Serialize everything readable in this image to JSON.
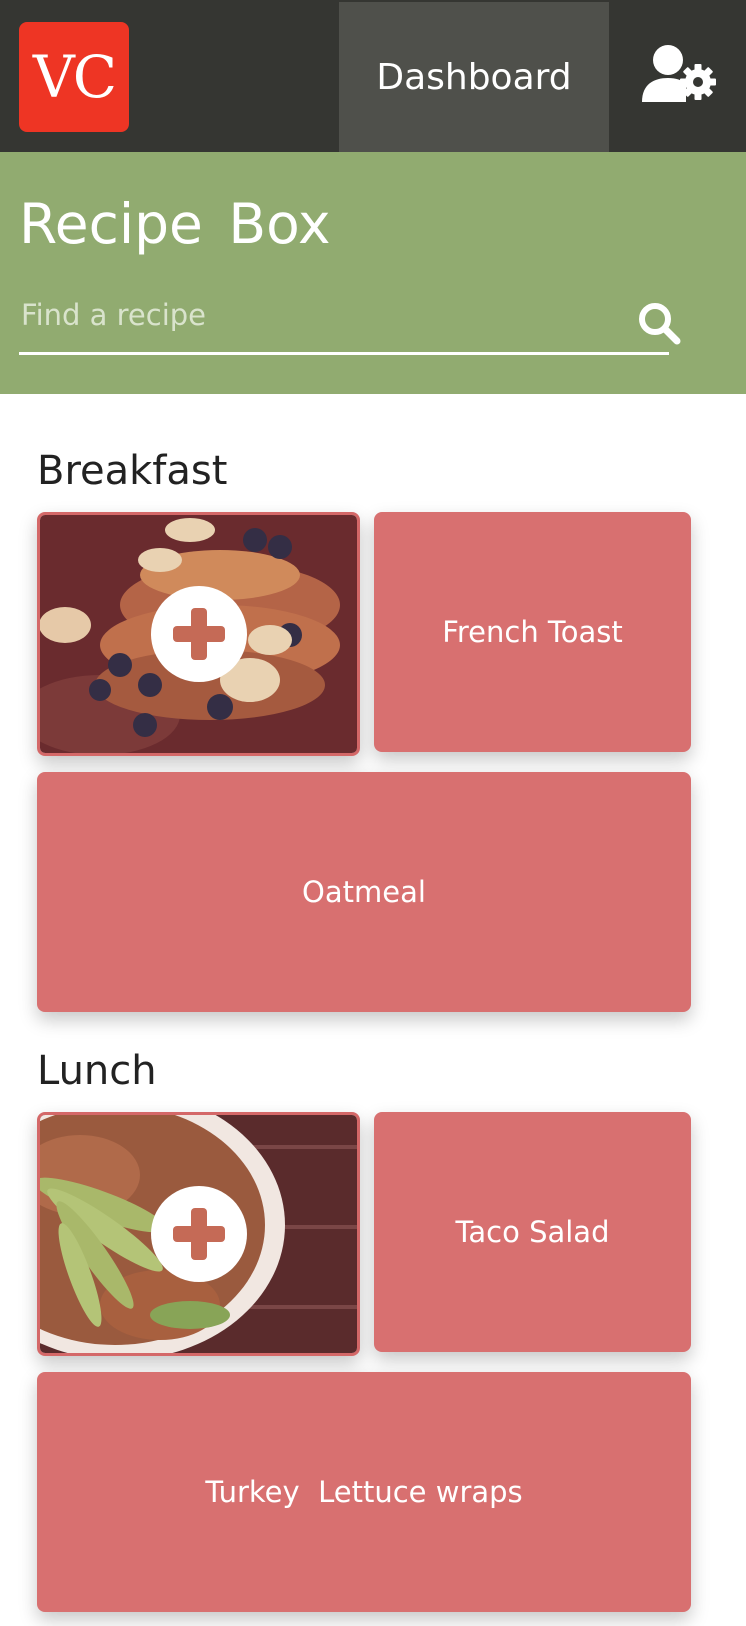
{
  "header": {
    "logo_text": "VC",
    "nav_dashboard": "Dashboard",
    "settings_icon": "user-gear-icon"
  },
  "hero": {
    "title": "Recipe Box",
    "search_placeholder": "Find a recipe",
    "search_icon": "search-icon"
  },
  "sections": [
    {
      "title": "Breakfast",
      "items": [
        "French Toast",
        "Oatmeal"
      ]
    },
    {
      "title": "Lunch",
      "items": [
        "Taco Salad",
        "Turkey  Lettuce wraps"
      ]
    }
  ],
  "colors": {
    "topbar": "#353632",
    "logo": "#ee3524",
    "hero": "#91ab70",
    "card": "#d87070"
  }
}
